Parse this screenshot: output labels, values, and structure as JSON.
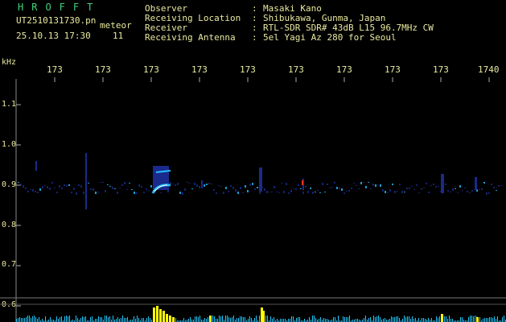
{
  "header": {
    "app_name": "HROFFT",
    "filename": "UT2510131730.pn",
    "detection_type": "meteor",
    "datetime": "25.10.13 17:30",
    "count": "11"
  },
  "meta": [
    {
      "label": "Observer",
      "value": "Masaki Kano"
    },
    {
      "label": "Receiving Location",
      "value": "Shibukawa, Gunma, Japan"
    },
    {
      "label": "Receiver",
      "value": "RTL-SDR SDR# 43dB L15 96.7MHz CW"
    },
    {
      "label": "Receiving Antenna",
      "value": "5el Yagi Az 280 for Seoul"
    }
  ],
  "chart_data": {
    "type": "heatmap",
    "ylabel_unit": "kHz",
    "x_tick_labels": [
      "173",
      "173",
      "173",
      "173",
      "173",
      "173",
      "173",
      "173",
      "173",
      "1740"
    ],
    "y_tick_labels": [
      "1.1",
      "1.0",
      "0.9",
      "0.8",
      "0.7",
      "0.6"
    ],
    "ylim": [
      0.6,
      1.1
    ],
    "grid": false,
    "colors": {
      "background": "#000000",
      "text": "#e9e9a0",
      "title": "#3fd27c",
      "signal_low": "#1a2a8c",
      "signal_mid": "#22c0ff",
      "signal_high": "#ffffff",
      "spectrum": "#20c8ff",
      "spike": "#ffff00"
    }
  }
}
